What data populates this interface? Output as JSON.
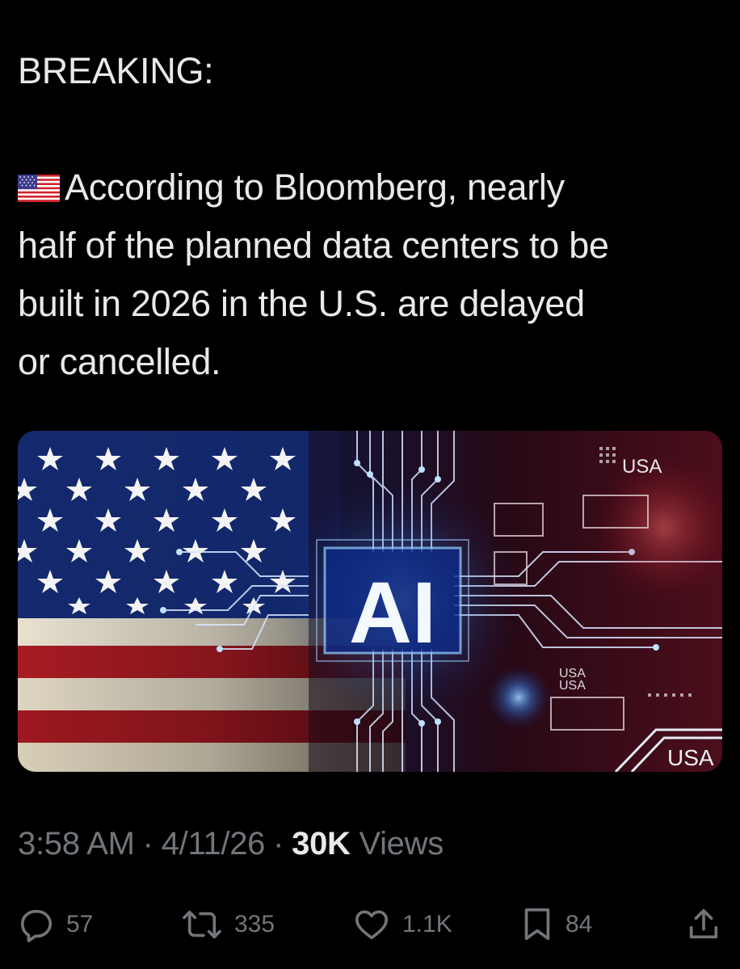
{
  "tweet": {
    "line_breaking": "BREAKING:",
    "flag_icon": "us-flag-emoji",
    "body_line1": "According to Bloomberg, nearly",
    "body_line2": "half of the planned data centers to be",
    "body_line3": "built in 2026 in the U.S. are delayed",
    "body_line4": "or cancelled."
  },
  "media": {
    "center_text": "AI",
    "label_top": "USA",
    "label_mid_1": "USA",
    "label_mid_2": "USA",
    "label_bottom": "USA"
  },
  "meta": {
    "time": "3:58 AM",
    "separator": "·",
    "date": "4/11/26",
    "views_count": "30K",
    "views_label": "Views"
  },
  "actions": {
    "replies": "57",
    "reposts": "335",
    "likes": "1.1K",
    "bookmarks": "84"
  },
  "colors": {
    "background": "#000000",
    "text": "#e7e9ea",
    "muted": "#71767b"
  }
}
